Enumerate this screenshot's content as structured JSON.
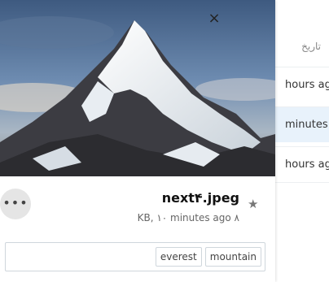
{
  "list": {
    "column_header": "تاريخ",
    "rows": [
      {
        "label": "hours ago"
      },
      {
        "label": "minutes a"
      },
      {
        "label": "hours ago"
      }
    ]
  },
  "detail": {
    "file_name": "next۴.jpeg",
    "meta": "KB, ۱۰ minutes ago ۸",
    "close_icon": "×",
    "more_icon": "•••",
    "star_icon": "★",
    "tags": [
      "mountain",
      "everest"
    ]
  },
  "colors": {
    "selected_row": "#e8f2fb",
    "more_button_bg": "#e5e5e5"
  }
}
